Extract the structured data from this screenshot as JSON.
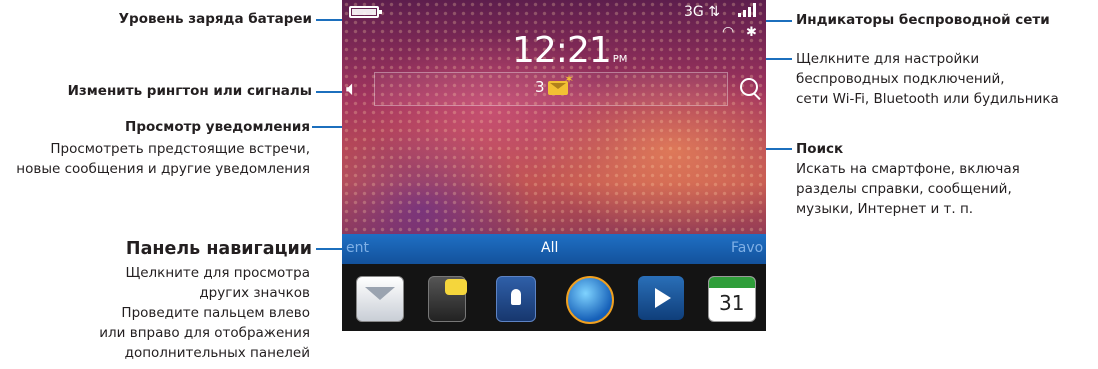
{
  "annotations": {
    "battery": "Уровень заряда батареи",
    "ringtone": "Изменить рингтон или сигналы",
    "notif_title": "Просмотр уведомления",
    "notif_desc1": "Просмотреть предстоящие встречи,",
    "notif_desc2": "новые сообщения и другие уведомления",
    "nav_title": "Панель навигации",
    "nav_desc1": "Щелкните для просмотра",
    "nav_desc2": "других значков",
    "nav_desc3": "Проведите пальцем влево",
    "nav_desc4": "или вправо для отображения",
    "nav_desc5": "дополнительных панелей",
    "wireless_title": "Индикаторы беспроводной сети",
    "wireless_desc1": "Щелкните для настройки",
    "wireless_desc2": "беспроводных подключений,",
    "wireless_desc3": "сети Wi-Fi, Bluetooth или будильника",
    "search_title": "Поиск",
    "search_desc1": "Искать на смартфоне, включая",
    "search_desc2": "разделы справки, сообщений,",
    "search_desc3": "музыки, Интернет и т. п."
  },
  "phone": {
    "network": "3G",
    "clock": "12:21",
    "ampm": "PM",
    "notification_count": "3",
    "nav": {
      "left": "ent",
      "center": "All",
      "right": "Favo"
    },
    "calendar_day": "31",
    "icons": [
      "battery-icon",
      "signal-icon",
      "wifi-icon",
      "bluetooth-icon",
      "speaker-icon",
      "search-icon",
      "message-icon",
      "messages-app-icon",
      "contacts-app-icon",
      "browser-app-icon",
      "media-app-icon",
      "calendar-app-icon"
    ]
  },
  "colors": {
    "callout_line": "#1c6fbd",
    "nav_bar": "#1f6fc4"
  }
}
